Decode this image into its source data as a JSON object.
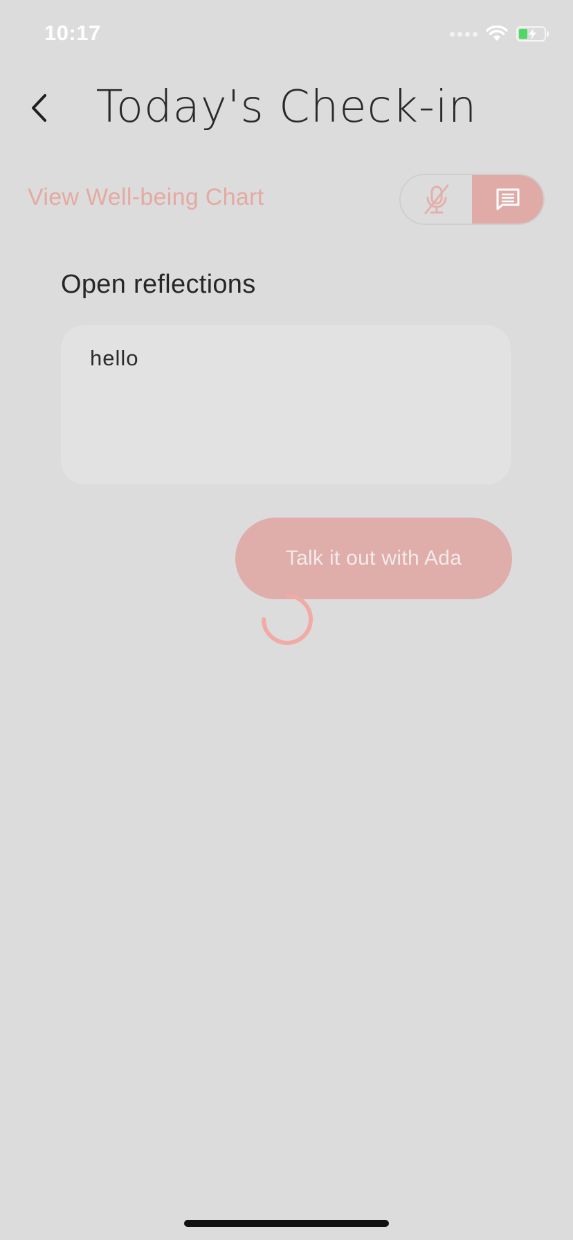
{
  "status_bar": {
    "time": "10:17"
  },
  "header": {
    "title": "Today's Check-in"
  },
  "chart_link": {
    "label": "View Well-being Chart"
  },
  "mode_toggle": {
    "voice_icon": "microphone-off-icon",
    "text_icon": "chat-bubble-icon",
    "active": "text"
  },
  "reflections": {
    "title": "Open reflections",
    "value": "hello"
  },
  "talk_button": {
    "label": "Talk it out with Ada"
  },
  "colors": {
    "accent": "#e0aaa7",
    "link": "#e4aaa2",
    "background": "#dcdcdc",
    "spinner": "#f1aaa5"
  }
}
